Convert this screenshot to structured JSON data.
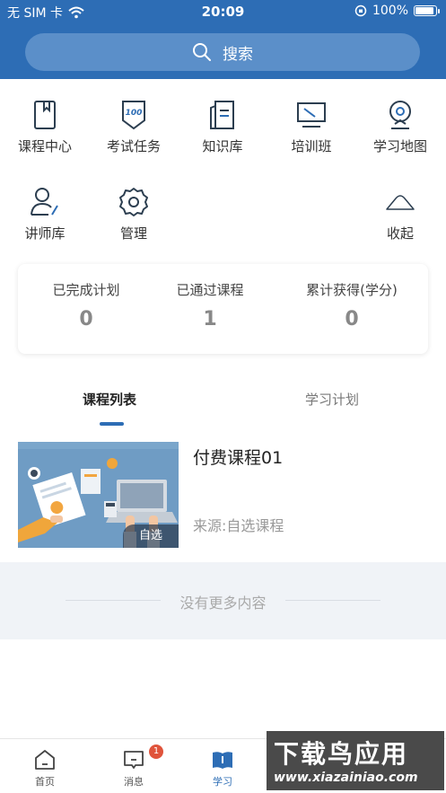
{
  "status_bar": {
    "carrier": "无 SIM 卡",
    "time": "20:09",
    "battery": "100%",
    "battery_level": 1.0
  },
  "search": {
    "placeholder": "搜索"
  },
  "grid": {
    "items": [
      {
        "label": "课程中心",
        "icon": "book-bookmark-icon"
      },
      {
        "label": "考试任务",
        "icon": "exam-100-icon"
      },
      {
        "label": "知识库",
        "icon": "document-library-icon"
      },
      {
        "label": "培训班",
        "icon": "presentation-board-icon"
      },
      {
        "label": "学习地图",
        "icon": "map-pin-icon"
      },
      {
        "label": "讲师库",
        "icon": "lecturer-icon"
      },
      {
        "label": "管理",
        "icon": "gear-icon"
      },
      {
        "label": "收起",
        "icon": "chevron-up-icon"
      }
    ]
  },
  "stats": [
    {
      "label": "已完成计划",
      "value": "0"
    },
    {
      "label": "已通过课程",
      "value": "1"
    },
    {
      "label": "累计获得(学分)",
      "value": "0"
    }
  ],
  "tabs": [
    {
      "label": "课程列表",
      "active": true
    },
    {
      "label": "学习计划",
      "active": false
    }
  ],
  "course": {
    "title": "付费课程01",
    "source": "来源:自选课程",
    "badge": "自选"
  },
  "no_more": "没有更多内容",
  "tabbar": {
    "items": [
      {
        "label": "首页",
        "icon": "home-icon"
      },
      {
        "label": "消息",
        "icon": "message-icon",
        "badge": "1"
      },
      {
        "label": "学习",
        "icon": "open-book-icon",
        "active": true
      }
    ]
  },
  "watermark": {
    "title": "下载鸟应用",
    "url": "www.xiazainiao.com"
  },
  "colors": {
    "primary": "#2d6db5",
    "badge": "#e0543b"
  }
}
